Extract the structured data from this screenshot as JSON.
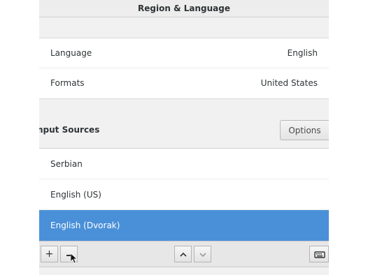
{
  "window": {
    "title": "Region & Language"
  },
  "settings": {
    "rows": [
      {
        "label": "Language",
        "value": "English"
      },
      {
        "label": "Formats",
        "value": "United States"
      }
    ]
  },
  "input_sources": {
    "section_title": "nput Sources",
    "options_label": "Options",
    "items": [
      {
        "label": "Serbian",
        "selected": false
      },
      {
        "label": "English (US)",
        "selected": false
      },
      {
        "label": "English (Dvorak)",
        "selected": true
      }
    ]
  },
  "toolbar": {
    "add_label": "+",
    "icons": [
      "plus-icon",
      "minus-icon",
      "chevron-up-icon",
      "chevron-down-icon",
      "keyboard-icon"
    ]
  },
  "colors": {
    "selection": "#4a90d9",
    "background": "#f1f1f1"
  }
}
